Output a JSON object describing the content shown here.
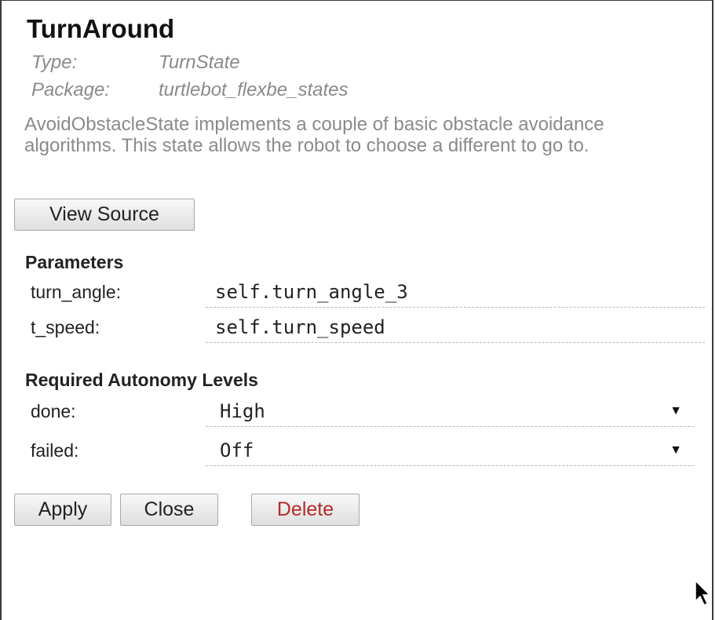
{
  "state": {
    "title": "TurnAround",
    "type_label": "Type:",
    "type_value": "TurnState",
    "package_label": "Package:",
    "package_value": "turtlebot_flexbe_states",
    "description": "AvoidObstacleState implements a couple of basic obstacle avoidance algorithms. This state allows the robot to choose a different to go to."
  },
  "buttons": {
    "view_source": "View Source",
    "apply": "Apply",
    "close": "Close",
    "delete": "Delete"
  },
  "parameters": {
    "heading": "Parameters",
    "items": [
      {
        "label": "turn_angle:",
        "value": "self.turn_angle_3"
      },
      {
        "label": "t_speed:",
        "value": "self.turn_speed"
      }
    ]
  },
  "autonomy": {
    "heading": "Required Autonomy Levels",
    "items": [
      {
        "label": "done:",
        "value": "High"
      },
      {
        "label": "failed:",
        "value": "Off"
      }
    ]
  },
  "colors": {
    "delete_text": "#b52a2a",
    "muted_text": "#8a8a8a"
  },
  "icons": {
    "dropdown": "triangle-down",
    "cursor": "mouse-pointer"
  }
}
